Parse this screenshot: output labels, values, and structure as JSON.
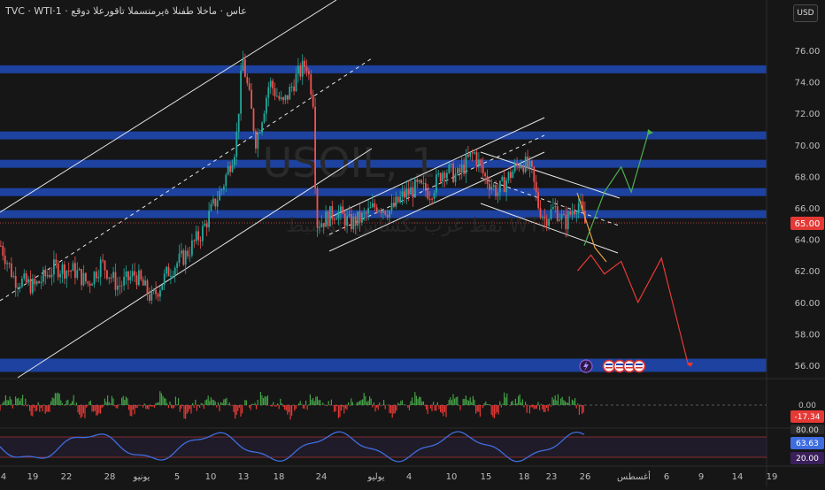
{
  "header": {
    "symbol_line": "TVC · WTI·عاس · ماخلا طفنلا ةيرمتسملا تاقورعلا دوقع · 1",
    "currency_button": "USD"
  },
  "watermark": {
    "ticker": "USOIL, 1",
    "name": "نفط غرب تكساس الوسيط WTI"
  },
  "price_axis": {
    "ticks": [
      "76.00",
      "74.00",
      "72.00",
      "70.00",
      "68.00",
      "66.00",
      "64.00",
      "62.00",
      "60.00",
      "58.00",
      "56.00"
    ],
    "current_price": "65.00",
    "current_price_color": "#e53935"
  },
  "time_axis": {
    "labels": [
      "4",
      "19",
      "22",
      "28",
      "يونيو",
      "5",
      "10",
      "13",
      "18",
      "24",
      "يوليو",
      "4",
      "10",
      "15",
      "18",
      "23",
      "26",
      "أغسطس",
      "6",
      "9",
      "14",
      "19"
    ]
  },
  "oscillator_1": {
    "zero_label": "0.00",
    "value_label": "-17.34",
    "value_color": "#e53935"
  },
  "oscillator_2": {
    "upper_label": "80.00",
    "value_label": "63.63",
    "value_color": "#3f6de0",
    "lower_label": "20.00"
  },
  "colors": {
    "background": "#161616",
    "zone_blue": "#1e44a8",
    "bull": "#26a69a",
    "bear": "#ef5350",
    "forecast_up": "#4caf50",
    "forecast_down": "#e53935",
    "forecast_orange": "#e8a33d"
  },
  "chart_data": {
    "type": "line",
    "description_scale": "price",
    "ylim": [
      55,
      77
    ],
    "support_resistance_zones": [
      74.8,
      70.6,
      68.8,
      67.0,
      65.6,
      56.0
    ],
    "price_path": [
      [
        0,
        63.6
      ],
      [
        4,
        61.5
      ],
      [
        10,
        61.0
      ],
      [
        16,
        62.2
      ],
      [
        22,
        62.0
      ],
      [
        26,
        61.2
      ],
      [
        30,
        62.5
      ],
      [
        35,
        61.0
      ],
      [
        40,
        61.8
      ],
      [
        45,
        60.2
      ],
      [
        50,
        62.0
      ],
      [
        55,
        63.0
      ],
      [
        60,
        64.5
      ],
      [
        63,
        66.0
      ],
      [
        66,
        67.3
      ],
      [
        70,
        70.0
      ],
      [
        72,
        75.5
      ],
      [
        74,
        73.0
      ],
      [
        76,
        70.2
      ],
      [
        78,
        72.0
      ],
      [
        80,
        74.0
      ],
      [
        84,
        72.5
      ],
      [
        88,
        74.3
      ],
      [
        91,
        75.2
      ],
      [
        93,
        73.0
      ],
      [
        94,
        65.0
      ],
      [
        96,
        65.2
      ],
      [
        100,
        65.8
      ],
      [
        104,
        65.0
      ],
      [
        108,
        65.4
      ],
      [
        112,
        66.2
      ],
      [
        116,
        65.8
      ],
      [
        120,
        66.8
      ],
      [
        124,
        67.3
      ],
      [
        128,
        67.0
      ],
      [
        132,
        68.5
      ],
      [
        136,
        68.0
      ],
      [
        139,
        69.0
      ],
      [
        141,
        69.5
      ],
      [
        144,
        68.0
      ],
      [
        148,
        67.0
      ],
      [
        152,
        68.2
      ],
      [
        155,
        69.0
      ],
      [
        158,
        68.3
      ],
      [
        160,
        66.2
      ],
      [
        162,
        65.3
      ],
      [
        165,
        66.0
      ],
      [
        168,
        65.0
      ],
      [
        170,
        65.8
      ],
      [
        172,
        66.4
      ],
      [
        174,
        65.0
      ]
    ],
    "forecast_green": [
      [
        174,
        63.6
      ],
      [
        180,
        67.0
      ],
      [
        185,
        68.6
      ],
      [
        188,
        67.0
      ],
      [
        193,
        70.7
      ]
    ],
    "forecast_red": [
      [
        172,
        62.0
      ],
      [
        176,
        63.0
      ],
      [
        180,
        61.8
      ],
      [
        185,
        62.6
      ],
      [
        190,
        60.0
      ],
      [
        197,
        62.8
      ],
      [
        205,
        56.0
      ]
    ]
  }
}
